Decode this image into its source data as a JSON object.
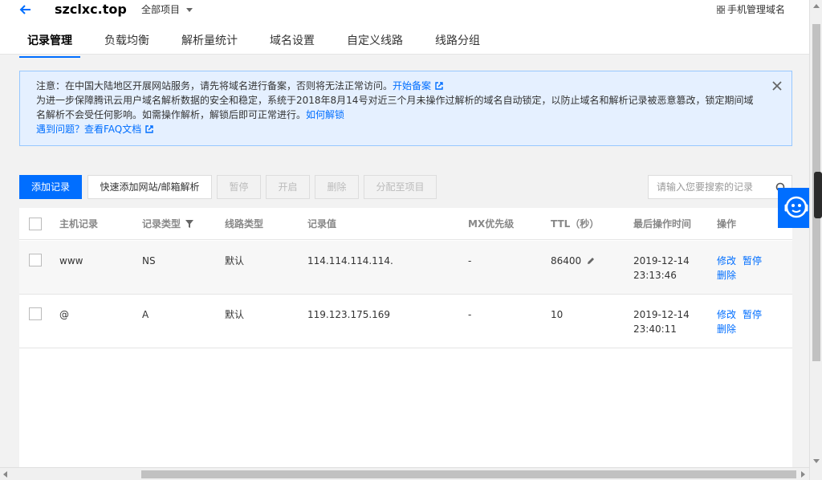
{
  "header": {
    "domain": "szclxc.top",
    "project_select": "全部项目",
    "mobile_manage": "手机管理域名"
  },
  "tabs": [
    {
      "label": "记录管理",
      "active": true
    },
    {
      "label": "负载均衡"
    },
    {
      "label": "解析量统计"
    },
    {
      "label": "域名设置"
    },
    {
      "label": "自定义线路"
    },
    {
      "label": "线路分组"
    }
  ],
  "notice": {
    "line1_text": "注意：在中国大陆地区开展网站服务，请先将域名进行备案，否则将无法正常访问。",
    "line1_link": "开始备案",
    "line2_text": "为进一步保障腾讯云用户域名解析数据的安全和稳定，系统于2018年8月14号对近三个月未操作过解析的域名自动锁定，以防止域名和解析记录被恶意篡改，锁定期间域名解析不会受任何影响。如需操作解析，解锁后即可正常进行。",
    "line2_link": "如何解锁",
    "line3_link": "遇到问题？查看FAQ文档"
  },
  "toolbar": {
    "add_record": "添加记录",
    "quick_add": "快速添加网站/邮箱解析",
    "pause": "暂停",
    "enable": "开启",
    "delete": "删除",
    "assign_project": "分配至项目",
    "search_placeholder": "请输入您要搜索的记录"
  },
  "table": {
    "headers": [
      "主机记录",
      "记录类型",
      "线路类型",
      "记录值",
      "MX优先级",
      "TTL（秒）",
      "最后操作时间",
      "操作"
    ],
    "rows": [
      {
        "host": "www",
        "type": "NS",
        "line": "默认",
        "value": "114.114.114.114.",
        "mx": "-",
        "ttl": "86400",
        "date": "2019-12-14",
        "time": "23:13:46",
        "edit": "修改",
        "pause": "暂停",
        "delete": "删除"
      },
      {
        "host": "@",
        "type": "A",
        "line": "默认",
        "value": "119.123.175.169",
        "mx": "-",
        "ttl": "10",
        "date": "2019-12-14",
        "time": "23:40:11",
        "edit": "修改",
        "pause": "暂停",
        "delete": "删除"
      }
    ]
  },
  "colors": {
    "accent": "#006eff",
    "notice_bg": "#e5f0ff",
    "notice_border": "#97c7ff"
  }
}
